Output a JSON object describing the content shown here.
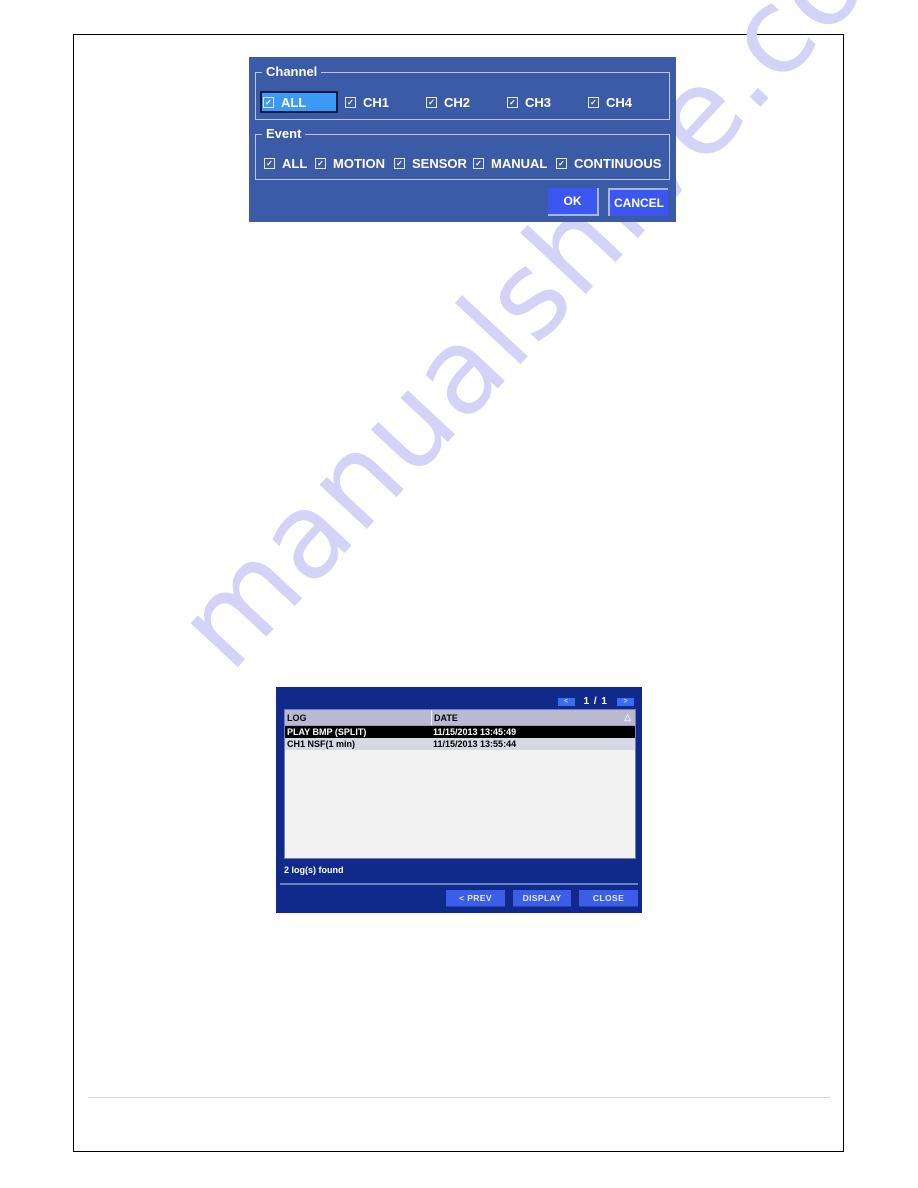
{
  "watermark": "manualshive.com",
  "filter_dialog": {
    "channel_group": {
      "title": "Channel",
      "items": [
        {
          "label": "ALL",
          "checked": true,
          "focused": true
        },
        {
          "label": "CH1",
          "checked": true
        },
        {
          "label": "CH2",
          "checked": true
        },
        {
          "label": "CH3",
          "checked": true
        },
        {
          "label": "CH4",
          "checked": true
        }
      ]
    },
    "event_group": {
      "title": "Event",
      "items": [
        {
          "label": "ALL",
          "checked": true
        },
        {
          "label": "MOTION",
          "checked": true
        },
        {
          "label": "SENSOR",
          "checked": true
        },
        {
          "label": "MANUAL",
          "checked": true
        },
        {
          "label": "CONTINUOUS",
          "checked": true
        }
      ]
    },
    "ok_label": "OK",
    "cancel_label": "CANCEL",
    "check_glyph": "✓",
    "colors": {
      "background": "#3c5ba6",
      "focus": "#3a9bf5",
      "button": "#3b57f0"
    }
  },
  "log_dialog": {
    "pager": {
      "prev_glyph": "<",
      "next_glyph": ">",
      "text": "1 / 1"
    },
    "columns": {
      "log": "LOG",
      "date": "DATE",
      "sort_glyph": "△"
    },
    "rows": [
      {
        "log": "PLAY BMP (SPLIT)",
        "date": "11/15/2013 13:45:49",
        "selected": true
      },
      {
        "log": "CH1 NSF(1 min)",
        "date": "11/15/2013 13:55:44",
        "selected": false
      }
    ],
    "count_text": "2 log(s) found",
    "prev_label": "< PREV",
    "display_label": "DISPLAY",
    "close_label": "CLOSE",
    "colors": {
      "background": "#0f2a8b",
      "button": "#3c5de8",
      "header": "#bab9d0"
    }
  }
}
